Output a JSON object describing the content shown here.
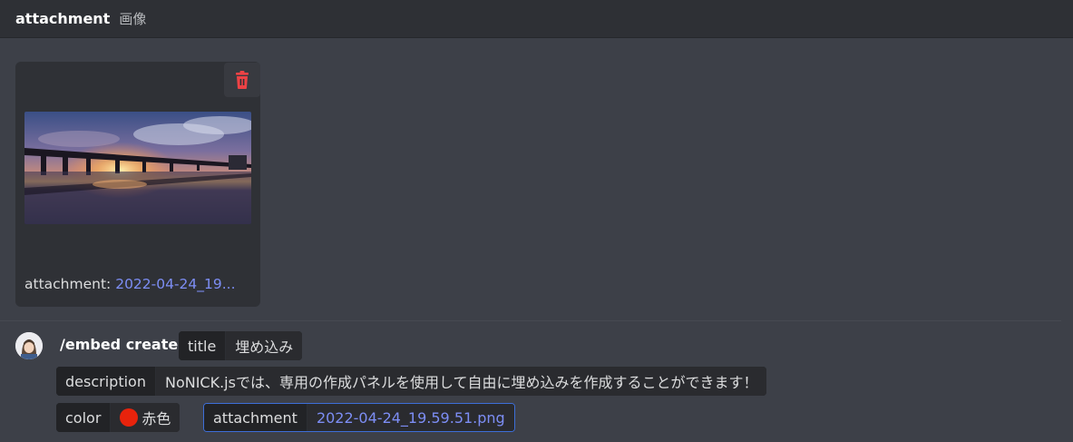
{
  "header": {
    "name": "attachment",
    "subtitle": "画像"
  },
  "attachment_card": {
    "caption_label": "attachment:",
    "caption_file": "2022-04-24_19..."
  },
  "command": {
    "name": "/embed create",
    "options": {
      "title": {
        "key": "title",
        "value": "埋め込み"
      },
      "description": {
        "key": "description",
        "value": "NoNICK.jsでは、専用の作成パネルを使用して自由に埋め込みを作成することができます！"
      },
      "color": {
        "key": "color",
        "value": "赤色"
      },
      "attachment": {
        "key": "attachment",
        "value": "2022-04-24_19.59.51.png"
      }
    }
  },
  "colors": {
    "accent_link": "#7d8ef5",
    "danger": "#ed4245",
    "color_swatch": "#e8230c"
  }
}
